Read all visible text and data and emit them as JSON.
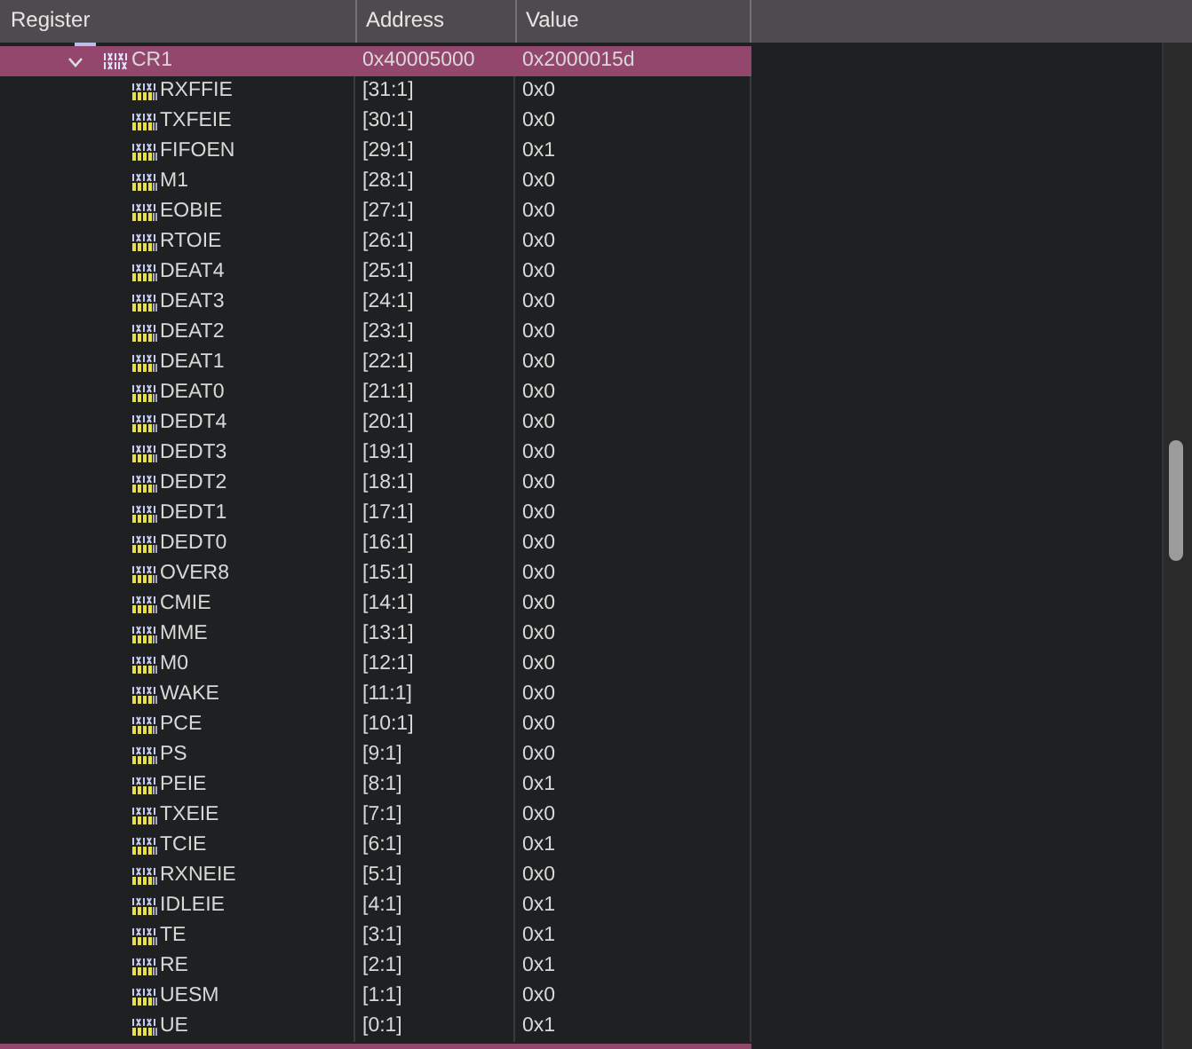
{
  "columns": [
    "Register",
    "Address",
    "Value"
  ],
  "register": {
    "name": "CR1",
    "address": "0x40005000",
    "value": "0x2000015d",
    "expanded": true,
    "selected": true
  },
  "fields": [
    {
      "name": "RXFFIE",
      "bits": "[31:1]",
      "value": "0x0"
    },
    {
      "name": "TXFEIE",
      "bits": "[30:1]",
      "value": "0x0"
    },
    {
      "name": "FIFOEN",
      "bits": "[29:1]",
      "value": "0x1"
    },
    {
      "name": "M1",
      "bits": "[28:1]",
      "value": "0x0"
    },
    {
      "name": "EOBIE",
      "bits": "[27:1]",
      "value": "0x0"
    },
    {
      "name": "RTOIE",
      "bits": "[26:1]",
      "value": "0x0"
    },
    {
      "name": "DEAT4",
      "bits": "[25:1]",
      "value": "0x0"
    },
    {
      "name": "DEAT3",
      "bits": "[24:1]",
      "value": "0x0"
    },
    {
      "name": "DEAT2",
      "bits": "[23:1]",
      "value": "0x0"
    },
    {
      "name": "DEAT1",
      "bits": "[22:1]",
      "value": "0x0"
    },
    {
      "name": "DEAT0",
      "bits": "[21:1]",
      "value": "0x0"
    },
    {
      "name": "DEDT4",
      "bits": "[20:1]",
      "value": "0x0"
    },
    {
      "name": "DEDT3",
      "bits": "[19:1]",
      "value": "0x0"
    },
    {
      "name": "DEDT2",
      "bits": "[18:1]",
      "value": "0x0"
    },
    {
      "name": "DEDT1",
      "bits": "[17:1]",
      "value": "0x0"
    },
    {
      "name": "DEDT0",
      "bits": "[16:1]",
      "value": "0x0"
    },
    {
      "name": "OVER8",
      "bits": "[15:1]",
      "value": "0x0"
    },
    {
      "name": "CMIE",
      "bits": "[14:1]",
      "value": "0x0"
    },
    {
      "name": "MME",
      "bits": "[13:1]",
      "value": "0x0"
    },
    {
      "name": "M0",
      "bits": "[12:1]",
      "value": "0x0"
    },
    {
      "name": "WAKE",
      "bits": "[11:1]",
      "value": "0x0"
    },
    {
      "name": "PCE",
      "bits": "[10:1]",
      "value": "0x0"
    },
    {
      "name": "PS",
      "bits": "[9:1]",
      "value": "0x0"
    },
    {
      "name": "PEIE",
      "bits": "[8:1]",
      "value": "0x1"
    },
    {
      "name": "TXEIE",
      "bits": "[7:1]",
      "value": "0x0"
    },
    {
      "name": "TCIE",
      "bits": "[6:1]",
      "value": "0x1"
    },
    {
      "name": "RXNEIE",
      "bits": "[5:1]",
      "value": "0x0"
    },
    {
      "name": "IDLEIE",
      "bits": "[4:1]",
      "value": "0x1"
    },
    {
      "name": "TE",
      "bits": "[3:1]",
      "value": "0x1"
    },
    {
      "name": "RE",
      "bits": "[2:1]",
      "value": "0x1"
    },
    {
      "name": "UESM",
      "bits": "[1:1]",
      "value": "0x0"
    },
    {
      "name": "UE",
      "bits": "[0:1]",
      "value": "0x1"
    }
  ]
}
